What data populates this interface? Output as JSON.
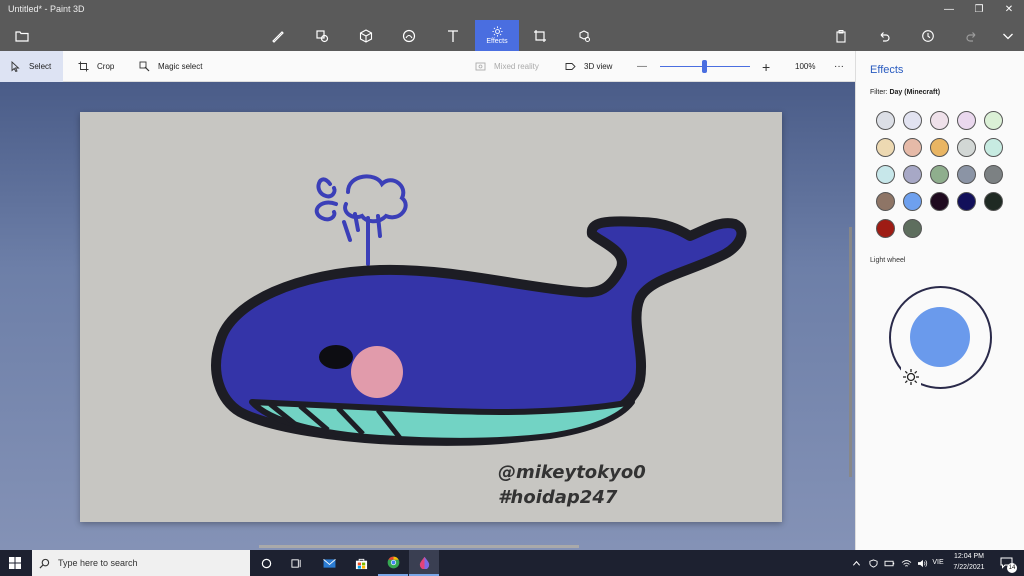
{
  "window": {
    "title": "Untitled* - Paint 3D",
    "minimize": "—",
    "restore": "❐",
    "close": "✕"
  },
  "toolbar": {
    "active_tool_label": "Effects"
  },
  "subbar": {
    "select": "Select",
    "crop": "Crop",
    "magic_select": "Magic select",
    "mixed_reality": "Mixed reality",
    "view_3d": "3D view",
    "zoom_minus": "—",
    "zoom_plus": "+",
    "zoom_level": "100%",
    "more": "···"
  },
  "canvas": {
    "watermark_line1": "@mikeytokyo0",
    "watermark_line2": "#hoidap247"
  },
  "panel": {
    "title": "Effects",
    "filter_label": "Filter:",
    "filter_value": "Day (Minecraft)",
    "light_wheel_label": "Light wheel",
    "swatch_colors": [
      "#dcdfe6",
      "#e2e3f1",
      "#efe1ea",
      "#ead8ee",
      "#dbf0d6",
      "#edd9b2",
      "#e6baa8",
      "#e9b563",
      "#d2d7d5",
      "#c7ebe1",
      "#c7e7ea",
      "#a7a8c6",
      "#8fae8d",
      "#8b94a5",
      "#7c8183",
      "#8e7566",
      "#6ea0ee",
      "#1f0a1f",
      "#12105a",
      "#1f2a23",
      "#9e1c14",
      "#5e6e5e"
    ],
    "light_color": "#6a9aec"
  },
  "taskbar": {
    "search_placeholder": "Type here to search",
    "language": "VIE",
    "time": "12:04 PM",
    "date": "7/22/2021",
    "notification_count": "14"
  }
}
